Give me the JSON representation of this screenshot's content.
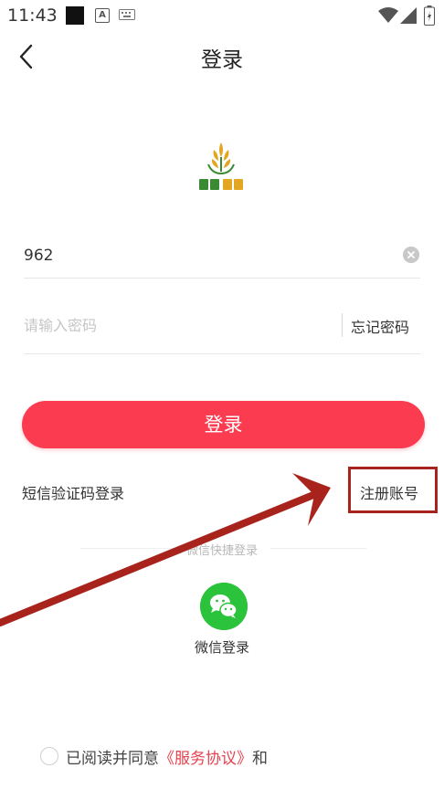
{
  "status_bar": {
    "time": "11:43",
    "notif_a": "A"
  },
  "header": {
    "title": "登录"
  },
  "form": {
    "phone_value": "962",
    "password_placeholder": "请输入密码",
    "forgot_label": "忘记密码",
    "login_label": "登录"
  },
  "links": {
    "sms_login": "短信验证码登录",
    "register": "注册账号"
  },
  "quick_login": {
    "label": "微信快捷登录",
    "wechat_label": "微信登录"
  },
  "agreement": {
    "prefix": "已阅读并同意",
    "link": "《服务协议》",
    "suffix": "和"
  },
  "colors": {
    "accent": "#fb3c50",
    "wechat": "#2bc33b",
    "annotation": "#a8231c"
  },
  "icons": [
    "back-icon",
    "clear-icon",
    "wechat-icon",
    "wifi-icon",
    "signal-icon",
    "battery-icon",
    "keyboard-icon"
  ]
}
